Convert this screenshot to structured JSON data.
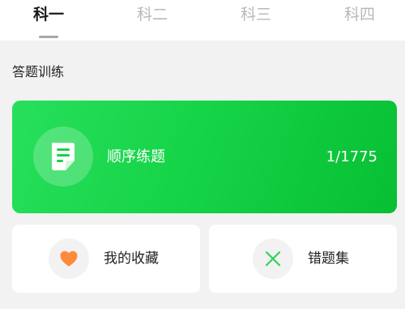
{
  "tabs": [
    {
      "label": "科一",
      "active": true
    },
    {
      "label": "科二",
      "active": false
    },
    {
      "label": "科三",
      "active": false
    },
    {
      "label": "科四",
      "active": false
    }
  ],
  "section": {
    "title": "答题训练"
  },
  "sequential_practice": {
    "icon": "book-icon",
    "label": "顺序练题",
    "progress": "1/1775",
    "color": "#16d448"
  },
  "favorites": {
    "icon": "heart-icon",
    "label": "我的收藏",
    "icon_color": "#ff8a3d"
  },
  "wrong_questions": {
    "icon": "cross-icon",
    "label": "错题集",
    "icon_color": "#2ed35a"
  }
}
